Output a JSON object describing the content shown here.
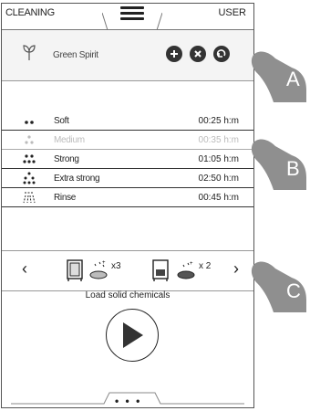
{
  "header": {
    "left_tab": "CLEANING",
    "right_tab": "USER",
    "menu_icon": "hamburger-menu-icon"
  },
  "program": {
    "name": "Green Spirit",
    "leaf_icon": "leaf-icon",
    "buttons": [
      "add-icon",
      "close-icon",
      "refresh-icon"
    ]
  },
  "modes": [
    {
      "label": "Soft",
      "time": "00:25 h:m",
      "icon": "drops-2-icon",
      "enabled": true
    },
    {
      "label": "Medium",
      "time": "00:35 h:m",
      "icon": "drops-3-icon",
      "enabled": false
    },
    {
      "label": "Strong",
      "time": "01:05 h:m",
      "icon": "drops-5-icon",
      "enabled": true
    },
    {
      "label": "Extra strong",
      "time": "02:50 h:m",
      "icon": "drops-6-icon",
      "enabled": true
    },
    {
      "label": "Rinse",
      "time": "00:45 h:m",
      "icon": "shower-icon",
      "enabled": true
    }
  ],
  "dosing": {
    "items": [
      {
        "count": "x3",
        "icon": "tablet-icon"
      },
      {
        "count": "x 2",
        "icon": "tablet-icon"
      }
    ],
    "prev_icon": "chevron-left-icon",
    "next_icon": "chevron-right-icon",
    "caption": "Load solid  chemicals"
  },
  "footer": {
    "more": "• • •"
  },
  "callouts": [
    "A",
    "B",
    "C"
  ],
  "colors": {
    "callout": "#8f8f8f",
    "dark": "#333333"
  }
}
